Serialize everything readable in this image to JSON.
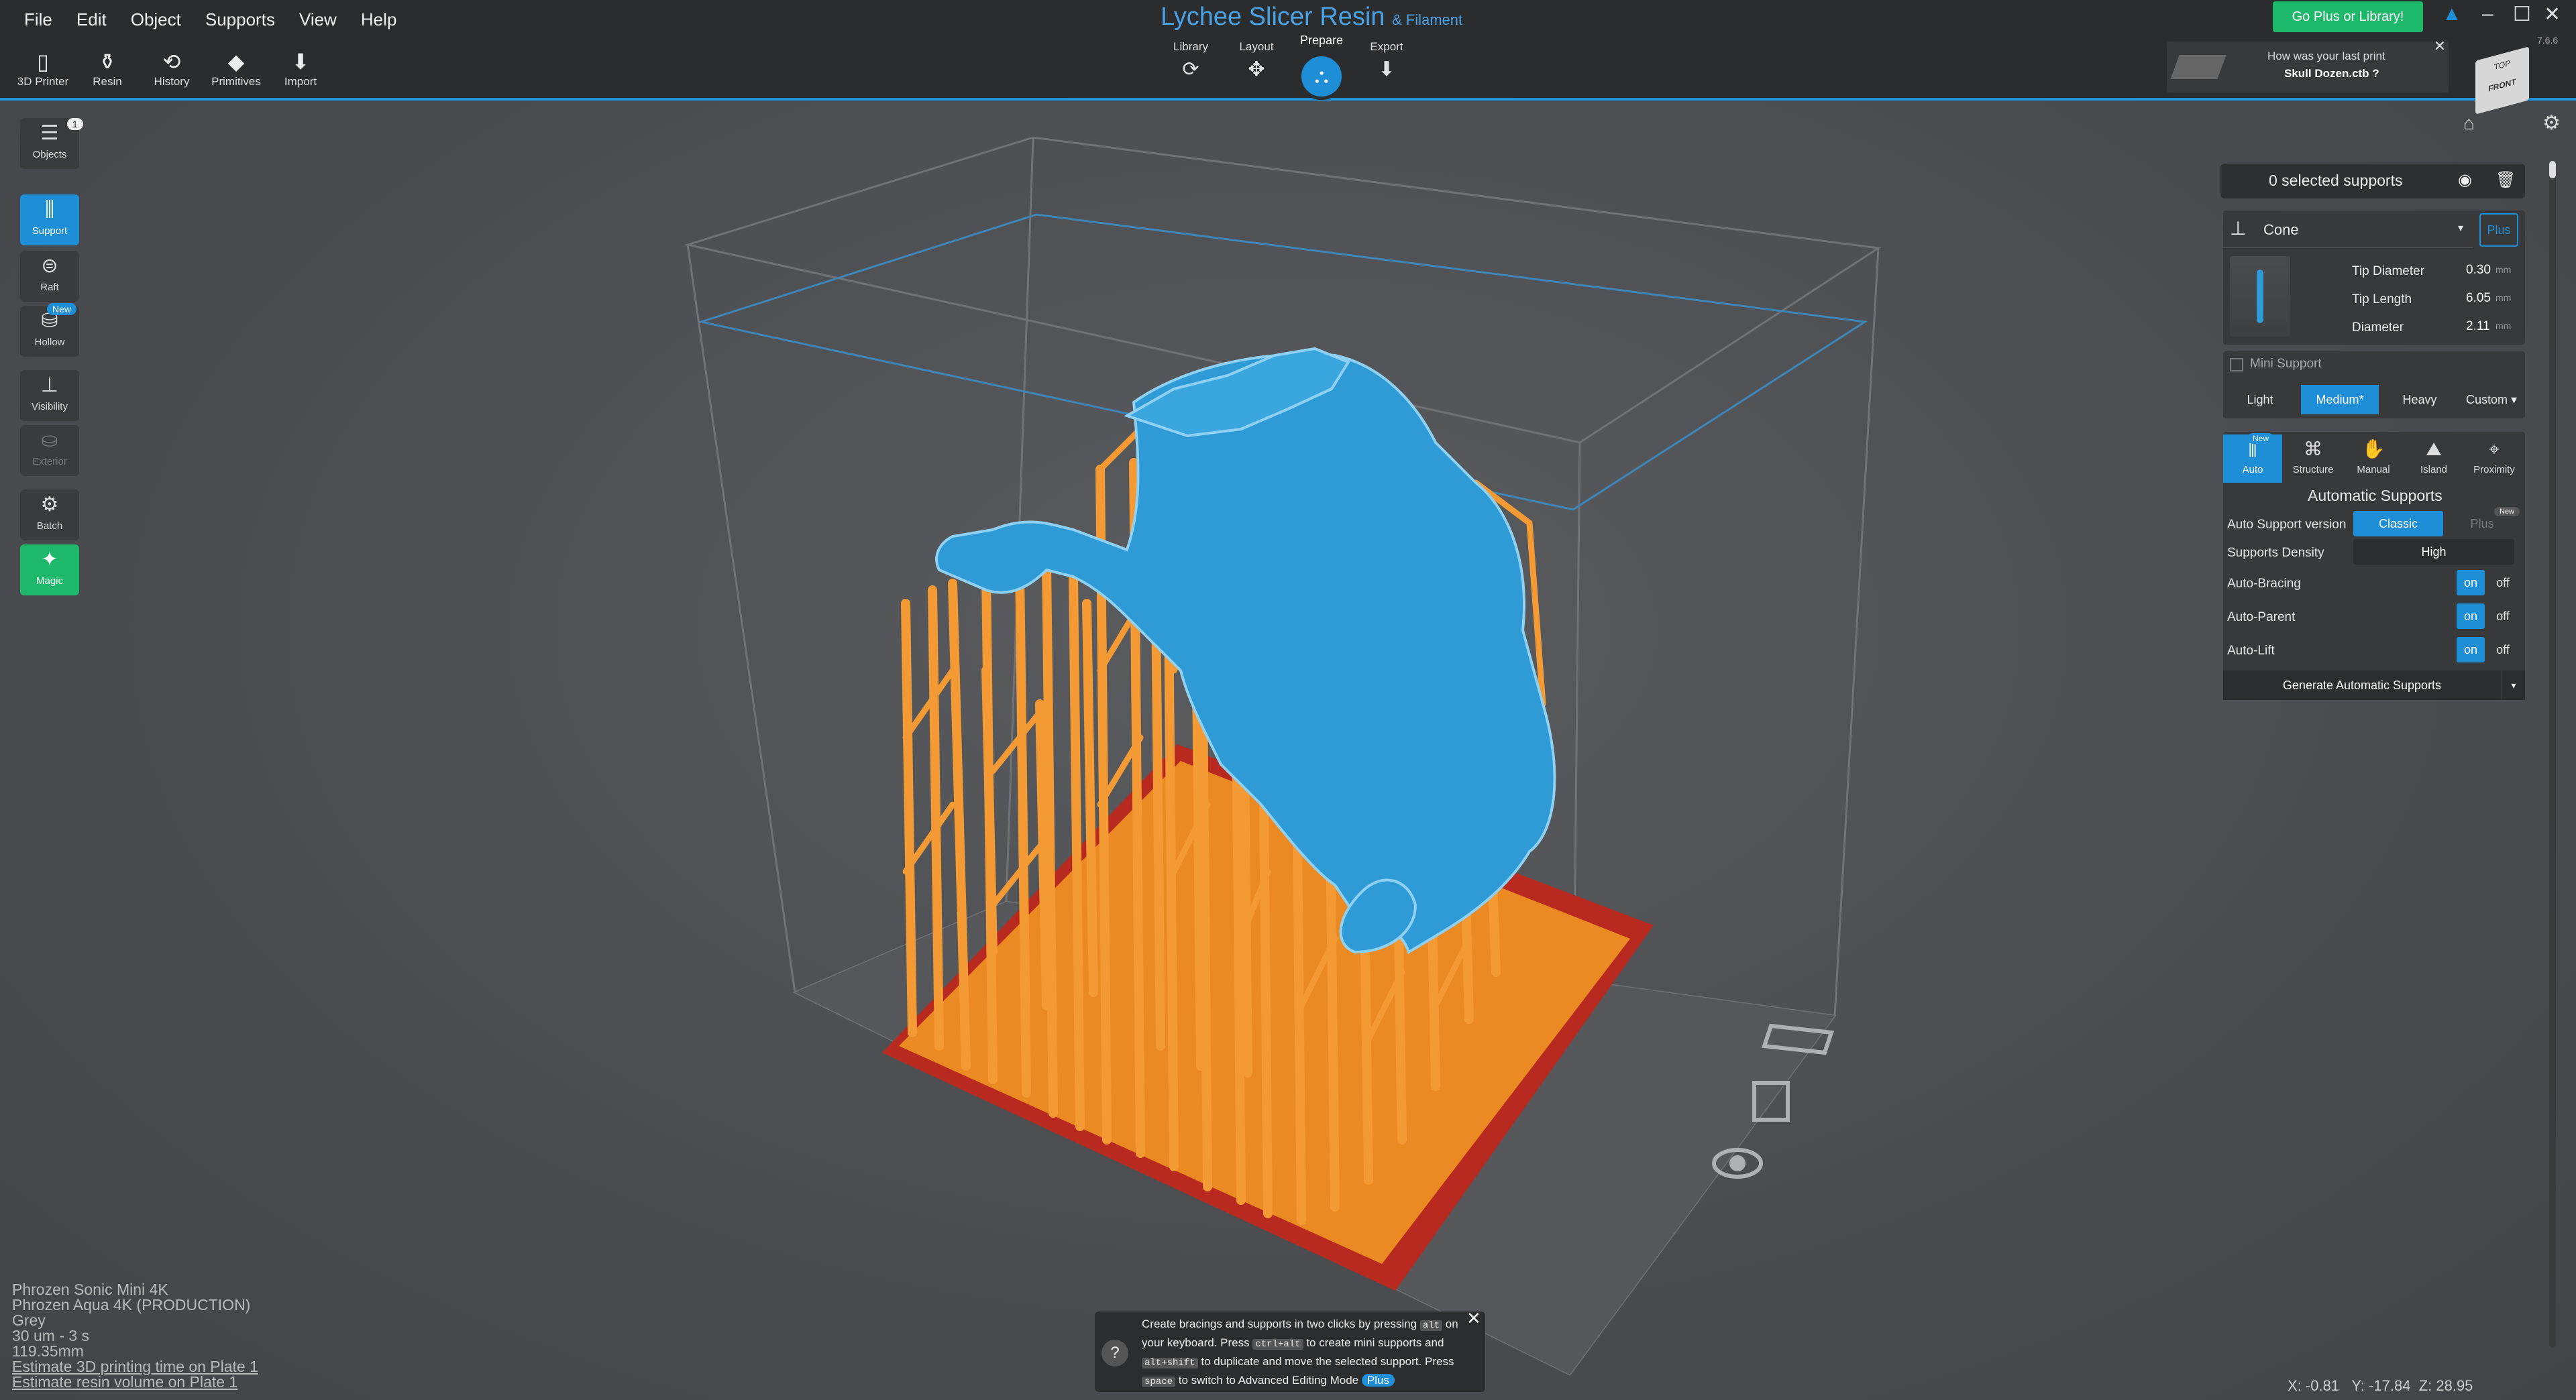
{
  "app": {
    "title": "Lychee Slicer Resin",
    "subtitle": "& Filament",
    "version": "7.6.6"
  },
  "menu": [
    "File",
    "Edit",
    "Object",
    "Supports",
    "View",
    "Help"
  ],
  "toolbar": [
    {
      "label": "3D Printer",
      "icon": "printer-icon"
    },
    {
      "label": "Resin",
      "icon": "resin-bottle-icon"
    },
    {
      "label": "History",
      "icon": "history-icon"
    },
    {
      "label": "Primitives",
      "icon": "shapes-icon"
    },
    {
      "label": "Import",
      "icon": "import-icon"
    }
  ],
  "steps": {
    "library": "Library",
    "layout": "Layout",
    "prepare": "Prepare",
    "export": "Export"
  },
  "go_plus": "Go Plus or Library!",
  "last_print": {
    "question": "How was your last print",
    "file": "Skull Dozen.ctb ?"
  },
  "view_cube": {
    "front": "FRONT",
    "top": "TOP"
  },
  "left": {
    "objects": "Objects",
    "objects_count": "1",
    "support": "Support",
    "raft": "Raft",
    "hollow": "Hollow",
    "hollow_badge": "New",
    "visibility": "Visibility",
    "exterior": "Exterior",
    "batch": "Batch",
    "magic": "Magic"
  },
  "supports": {
    "selected": "0 selected supports",
    "type": "Cone",
    "plus": "Plus",
    "params": [
      {
        "label": "Tip Diameter",
        "value": "0.30",
        "unit": "mm"
      },
      {
        "label": "Tip Length",
        "value": "6.05",
        "unit": "mm"
      },
      {
        "label": "Diameter",
        "value": "2.11",
        "unit": "mm"
      }
    ],
    "mini": "Mini Support",
    "presets": [
      "Light",
      "Medium*",
      "Heavy",
      "Custom ▾"
    ],
    "tabs": [
      {
        "label": "Auto",
        "badge": "New"
      },
      {
        "label": "Structure"
      },
      {
        "label": "Manual"
      },
      {
        "label": "Island"
      },
      {
        "label": "Proximity"
      }
    ],
    "auto_title": "Automatic Supports",
    "version_label": "Auto Support version",
    "version_classic": "Classic",
    "version_plus": "Plus",
    "version_plus_badge": "New",
    "density_label": "Supports Density",
    "density_value": "High",
    "toggles": [
      {
        "label": "Auto-Bracing",
        "on": "on",
        "off": "off"
      },
      {
        "label": "Auto-Parent",
        "on": "on",
        "off": "off"
      },
      {
        "label": "Auto-Lift",
        "on": "on",
        "off": "off"
      }
    ],
    "generate": "Generate Automatic Supports"
  },
  "info": [
    "Phrozen Sonic Mini 4K",
    "Phrozen Aqua 4K (PRODUCTION)",
    "Grey",
    "30 um - 3 s",
    "119.35mm",
    "Estimate 3D printing time on Plate 1",
    "Estimate resin volume on Plate 1"
  ],
  "tip": {
    "l1a": "Create bracings and supports in two clicks by pressing",
    "k1": "alt",
    "l2a": "on your keyboard. Press",
    "k2": "ctrl+alt",
    "l2b": "to create mini supports",
    "l3a": "and",
    "k3": "alt+shift",
    "l3b": "to duplicate and move the selected support.",
    "l4a": "Press",
    "k4": "space",
    "l4b": "to switch to Advanced Editing Mode",
    "plus": "Plus"
  },
  "coords": {
    "x": "X: -0.81",
    "y": "Y: -17.84",
    "z": "Z: 28.95"
  },
  "colors": {
    "accent": "#1e8ed6",
    "model": "#2f9bd6",
    "support": "#f0922b",
    "plate": "#e88a22",
    "danger": "#c0201e",
    "green": "#1db86a"
  }
}
